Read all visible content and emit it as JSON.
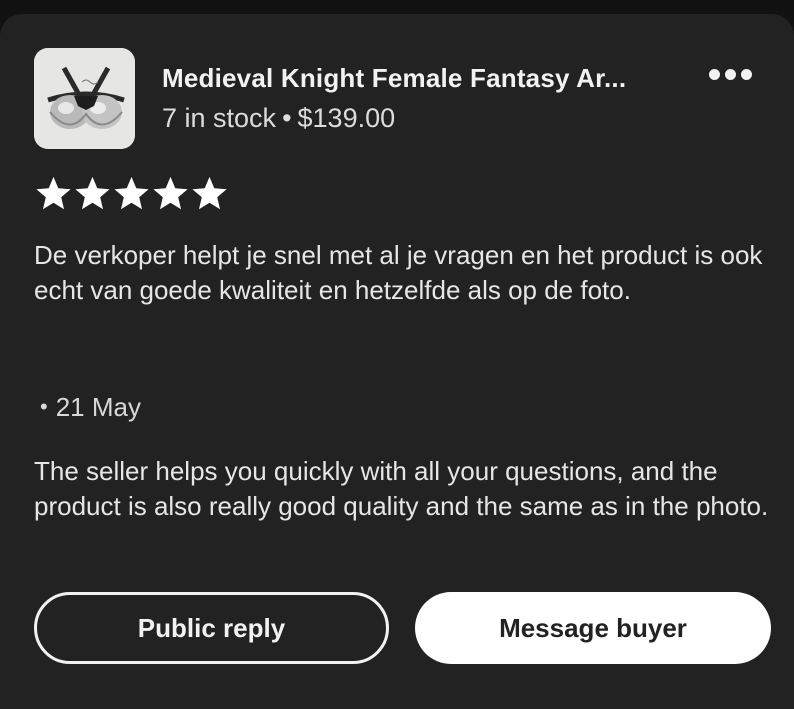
{
  "listing": {
    "title": "Medieval Knight Female Fantasy Ar...",
    "stock": "7 in stock",
    "separator": "•",
    "price": "$139.00",
    "thumbnail_icon": "armor-bra-product-photo"
  },
  "menu": {
    "icon": "more-horizontal-icon"
  },
  "review": {
    "rating": 5,
    "rating_max": 5,
    "text": "De verkoper helpt je snel met al je vragen en het product is ook echt van goede kwaliteit en hetzelfde als op de foto.",
    "date_bullet": "•",
    "date": "21 May",
    "translation": "The seller helps you quickly with all your questions, and the product is also really good quality and the same as in the photo."
  },
  "actions": {
    "public_reply_label": "Public reply",
    "message_buyer_label": "Message buyer"
  },
  "colors": {
    "background": "#222222",
    "text": "#e6e6e6",
    "star": "#ffffff",
    "button_solid": "#ffffff"
  }
}
